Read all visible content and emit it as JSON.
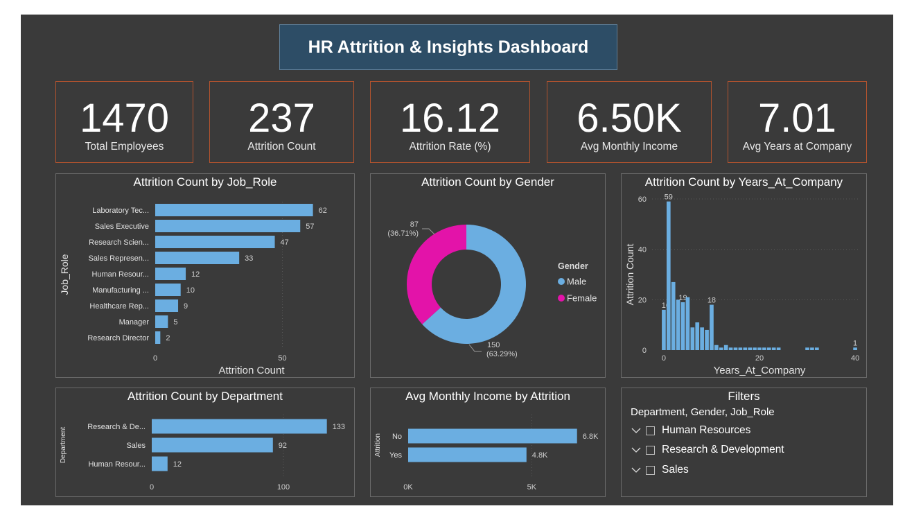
{
  "dashboard": {
    "title": "HR Attrition & Insights Dashboard"
  },
  "kpis": [
    {
      "value": "1470",
      "label": "Total Employees"
    },
    {
      "value": "237",
      "label": "Attrition Count"
    },
    {
      "value": "16.12",
      "label": "Attrition Rate (%)"
    },
    {
      "value": "6.50K",
      "label": "Avg Monthly Income"
    },
    {
      "value": "7.01",
      "label": "Avg Years at Company"
    }
  ],
  "colors": {
    "bar": "#6baee1",
    "male": "#6baee1",
    "female": "#e313a9",
    "kpi_border": "#b3532e",
    "title_bg": "#2d4d66",
    "canvas_bg": "#3a3a3a"
  },
  "chart_data": [
    {
      "type": "bar",
      "orientation": "horizontal",
      "title": "Attrition Count by Job_Role",
      "xlabel": "Attrition Count",
      "ylabel": "Job_Role",
      "categories": [
        "Laboratory Tec...",
        "Sales Executive",
        "Research Scien...",
        "Sales Represen...",
        "Human Resour...",
        "Manufacturing ...",
        "Healthcare Rep...",
        "Manager",
        "Research Director"
      ],
      "values": [
        62,
        57,
        47,
        33,
        12,
        10,
        9,
        5,
        2
      ],
      "xticks": [
        "0",
        "50"
      ],
      "xlim": [
        0,
        73
      ]
    },
    {
      "type": "pie",
      "donut": true,
      "title": "Attrition Count by Gender",
      "legend_title": "Gender",
      "legend_position": "right",
      "slices": [
        {
          "name": "Male",
          "value": 150,
          "label": "150",
          "percent": "(63.29%)"
        },
        {
          "name": "Female",
          "value": 87,
          "label": "87",
          "percent": "(36.71%)"
        }
      ]
    },
    {
      "type": "bar",
      "orientation": "vertical",
      "title": "Attrition Count by Years_At_Company",
      "xlabel": "Years_At_Company",
      "ylabel": "Attrition Count",
      "x": [
        0,
        1,
        2,
        3,
        4,
        5,
        6,
        7,
        8,
        9,
        10,
        11,
        12,
        13,
        14,
        15,
        16,
        17,
        18,
        19,
        20,
        21,
        22,
        23,
        24,
        30,
        31,
        32,
        40
      ],
      "values": [
        16,
        59,
        27,
        20,
        19,
        21,
        9,
        11,
        9,
        8,
        18,
        2,
        1,
        2,
        1,
        1,
        1,
        1,
        1,
        1,
        1,
        1,
        1,
        1,
        1,
        1,
        1,
        1,
        1
      ],
      "data_labels": {
        "1": "59",
        "0": "16",
        "4": "19",
        "10": "18",
        "40": "1"
      },
      "yticks": [
        "0",
        "20",
        "40",
        "60"
      ],
      "xticks": [
        "0",
        "20",
        "40"
      ],
      "ylim": [
        0,
        60
      ],
      "xlim": [
        -1,
        41
      ],
      "grid": true
    },
    {
      "type": "bar",
      "orientation": "horizontal",
      "title": "Attrition Count by Department",
      "ylabel": "Department",
      "categories": [
        "Research & De...",
        "Sales",
        "Human Resour..."
      ],
      "values": [
        133,
        92,
        12
      ],
      "xticks": [
        "0",
        "100"
      ],
      "xlim": [
        0,
        150
      ]
    },
    {
      "type": "bar",
      "orientation": "horizontal",
      "title": "Avg Monthly Income by Attrition",
      "ylabel": "Attrition",
      "categories": [
        "No",
        "Yes"
      ],
      "values": [
        6832,
        4787
      ],
      "data_labels": [
        "6.8K",
        "4.8K"
      ],
      "xticks": [
        "0K",
        "5K"
      ],
      "xlim": [
        0,
        7400
      ]
    }
  ],
  "filters": {
    "title": "Filters",
    "subtitle": "Department, Gender, Job_Role",
    "items": [
      "Human Resources",
      "Research & Development",
      "Sales"
    ]
  }
}
